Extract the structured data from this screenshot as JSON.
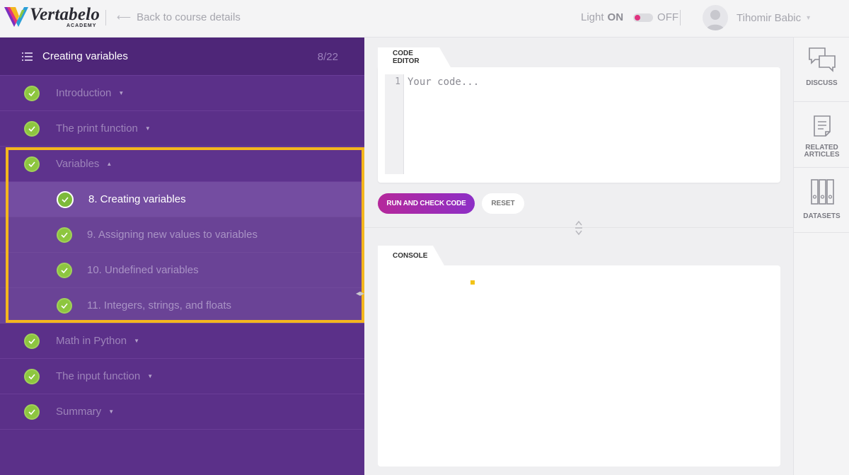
{
  "header": {
    "logo_text": "Vertabelo",
    "logo_sub": "ACADEMY",
    "back_label": "Back to course details",
    "theme_light": "Light",
    "theme_on": "ON",
    "theme_off": "OFF",
    "user_name": "Tihomir Babic"
  },
  "sidebar": {
    "title": "Creating variables",
    "progress": "8/22",
    "chapters": [
      {
        "label": "Introduction"
      },
      {
        "label": "The print function"
      },
      {
        "label": "Variables"
      },
      {
        "label": "Math in Python"
      },
      {
        "label": "The input function"
      },
      {
        "label": "Summary"
      }
    ],
    "lessons": [
      {
        "label": "8. Creating variables"
      },
      {
        "label": "9. Assigning new values to variables"
      },
      {
        "label": "10. Undefined variables"
      },
      {
        "label": "11. Integers, strings, and floats"
      }
    ]
  },
  "editor": {
    "tab_label": "CODE EDITOR",
    "line_number": "1",
    "placeholder": "Your code...",
    "run_label": "RUN AND CHECK CODE",
    "reset_label": "RESET"
  },
  "console": {
    "tab_label": "CONSOLE"
  },
  "rail": {
    "discuss": "DISCUSS",
    "articles": "RELATED ARTICLES",
    "datasets": "DATASETS"
  },
  "colors": {
    "sidebar_bg": "#5b3089",
    "highlight": "#f4b61e",
    "check": "#8dc63f",
    "run_start": "#b5289b",
    "run_end": "#8d2fc6"
  }
}
